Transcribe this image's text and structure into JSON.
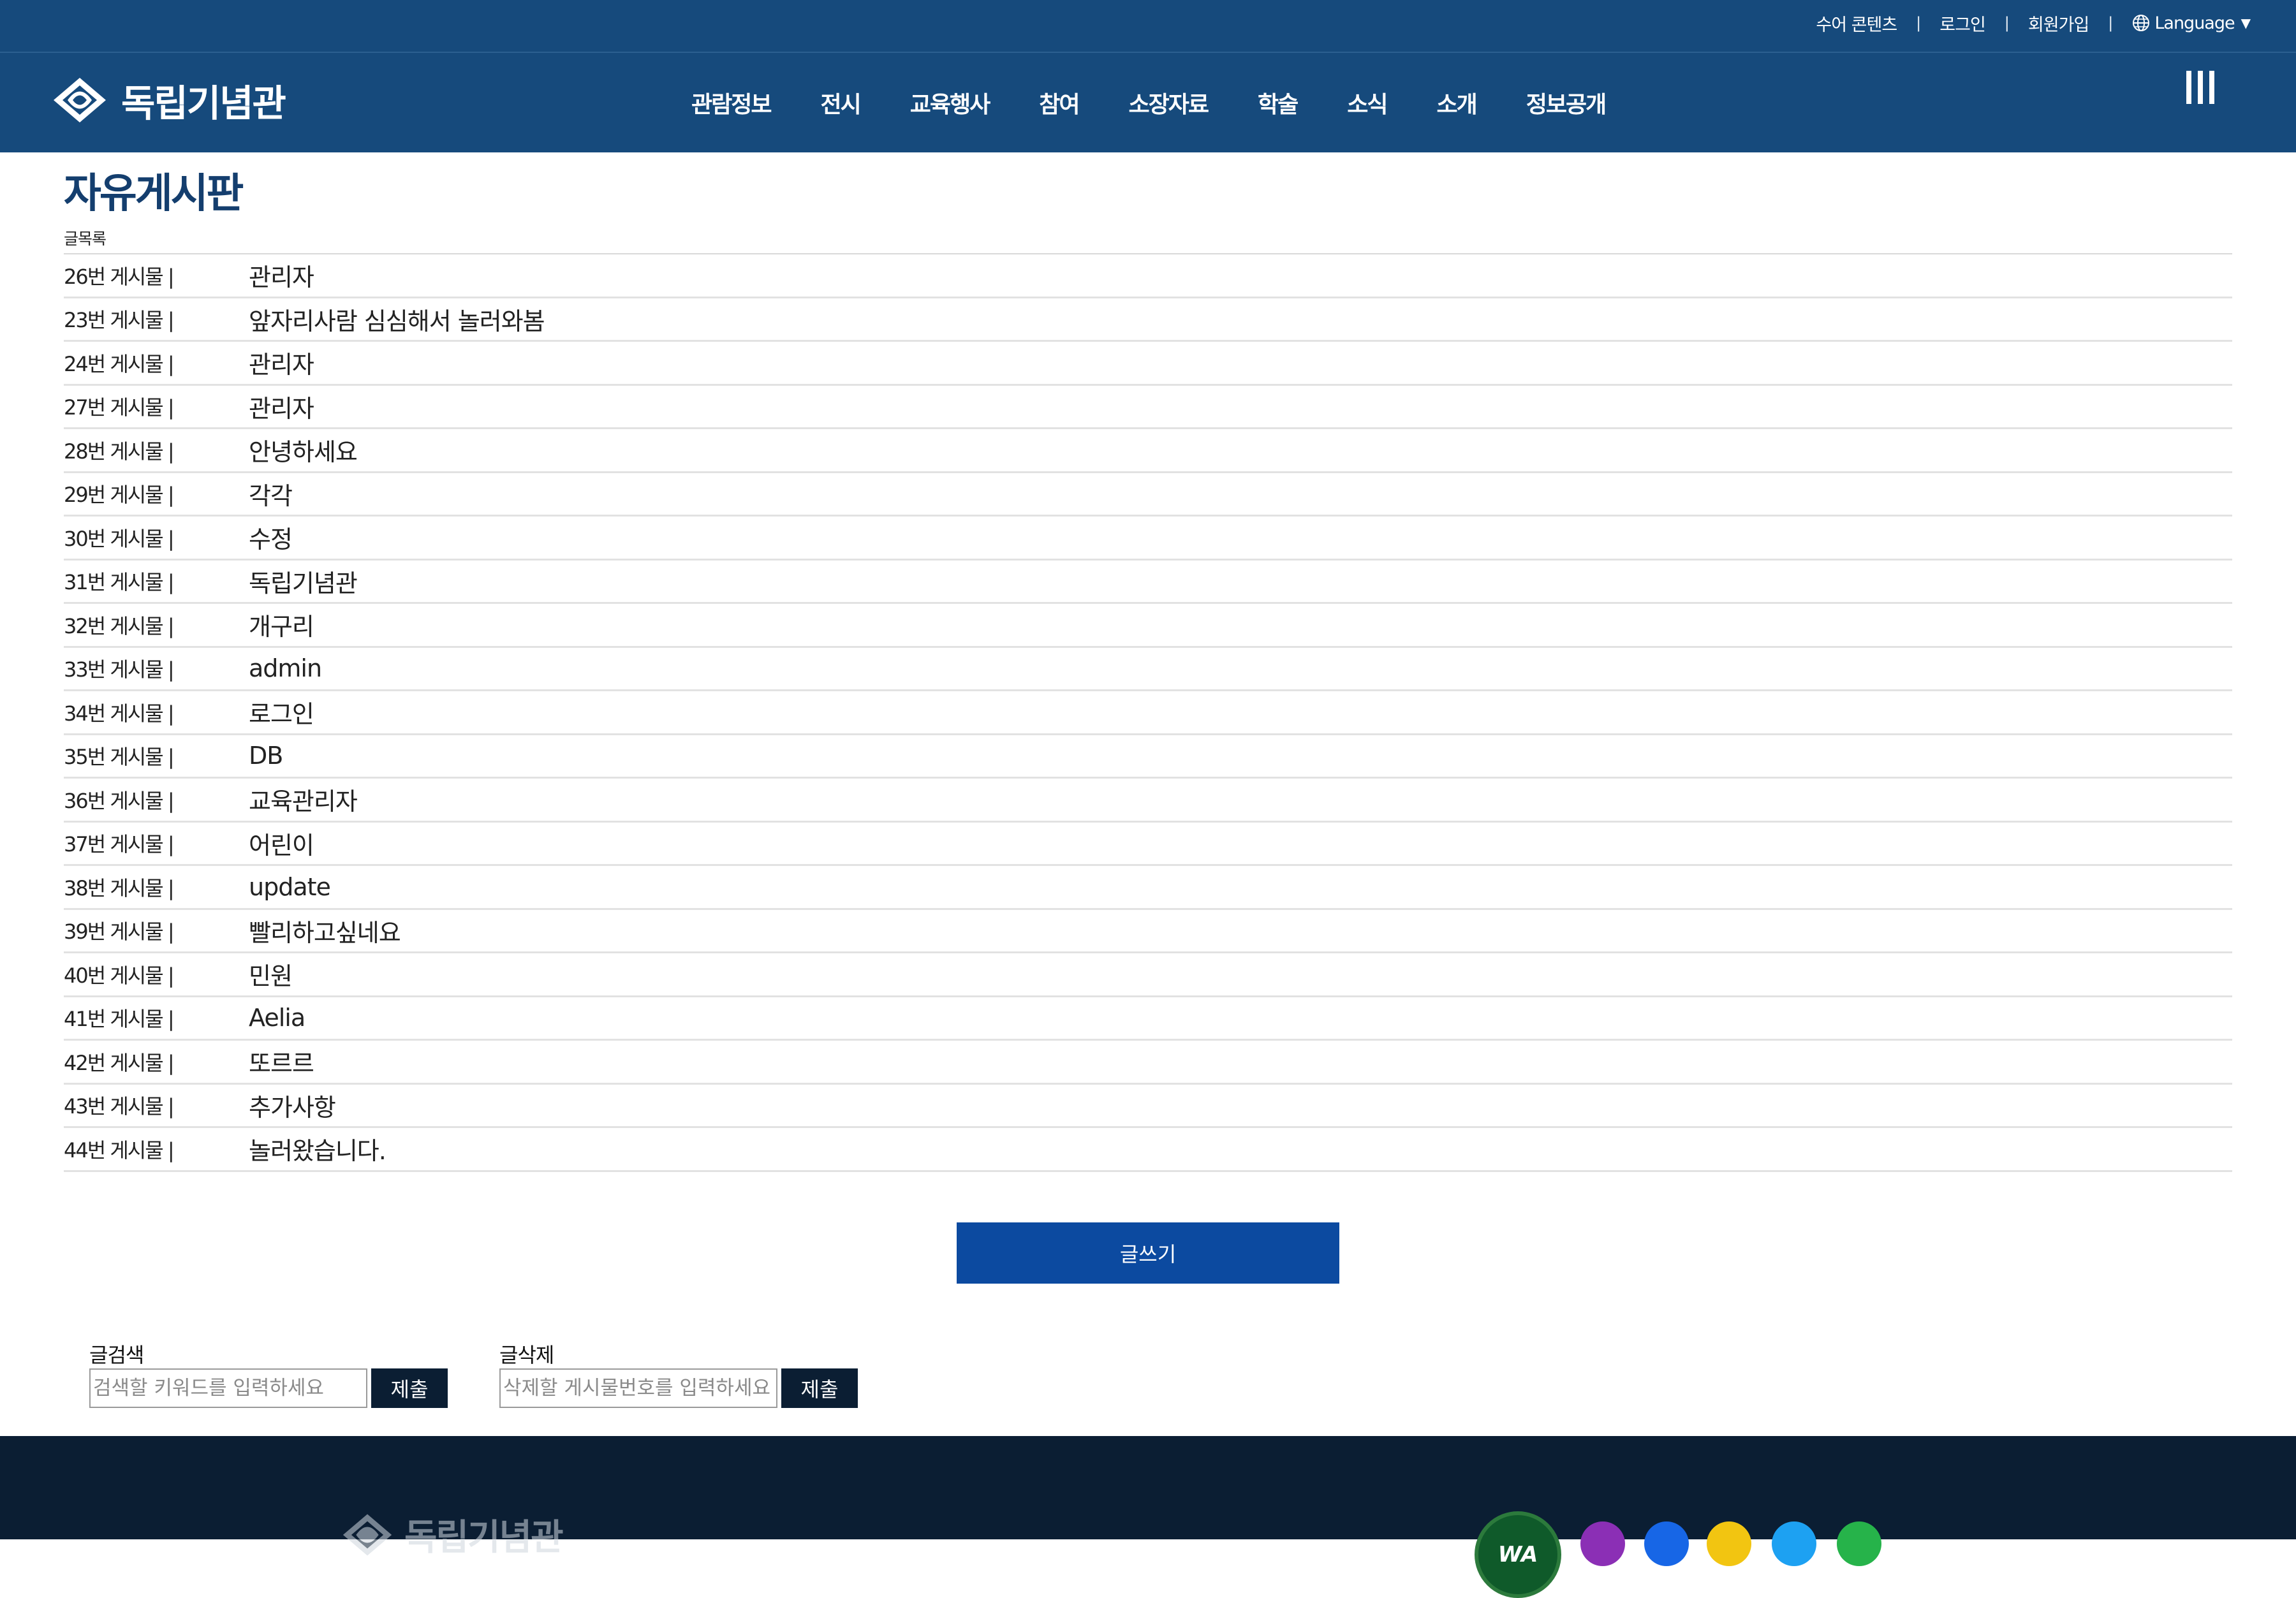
{
  "header": {
    "utility_links": [
      "수어 콘텐츠",
      "로그인",
      "회원가입"
    ],
    "separator": "|",
    "language_label": "Language",
    "language_caret": "▼",
    "logo_text": "독립기념관",
    "menu": [
      "관람정보",
      "전시",
      "교육행사",
      "참여",
      "소장자료",
      "학술",
      "소식",
      "소개",
      "정보공개"
    ]
  },
  "board": {
    "title": "자유게시판",
    "list_caption": "글목록",
    "posts": [
      {
        "num": "26번 게시물 |",
        "title": "관리자"
      },
      {
        "num": "23번 게시물 |",
        "title": "앞자리사람 심심해서 놀러와봄"
      },
      {
        "num": "24번 게시물 |",
        "title": "관리자"
      },
      {
        "num": "27번 게시물 |",
        "title": "관리자"
      },
      {
        "num": "28번 게시물 |",
        "title": "안녕하세요"
      },
      {
        "num": "29번 게시물 |",
        "title": "각각"
      },
      {
        "num": "30번 게시물 |",
        "title": "수정"
      },
      {
        "num": "31번 게시물 |",
        "title": "독립기념관"
      },
      {
        "num": "32번 게시물 |",
        "title": "개구리"
      },
      {
        "num": "33번 게시물 |",
        "title": "admin"
      },
      {
        "num": "34번 게시물 |",
        "title": "로그인"
      },
      {
        "num": "35번 게시물 |",
        "title": "DB"
      },
      {
        "num": "36번 게시물 |",
        "title": "교육관리자"
      },
      {
        "num": "37번 게시물 |",
        "title": "어린이"
      },
      {
        "num": "38번 게시물 |",
        "title": "update"
      },
      {
        "num": "39번 게시물 |",
        "title": "빨리하고싶네요"
      },
      {
        "num": "40번 게시물 |",
        "title": "민원"
      },
      {
        "num": "41번 게시물 |",
        "title": "Aelia"
      },
      {
        "num": "42번 게시물 |",
        "title": "또르르"
      },
      {
        "num": "43번 게시물 |",
        "title": "추가사항"
      },
      {
        "num": "44번 게시물 |",
        "title": "놀러왔습니다."
      }
    ],
    "write_button": "글쓰기"
  },
  "search_form": {
    "label": "글검색",
    "placeholder": "검색할 키워드를 입력하세요",
    "value": "",
    "submit": "제출"
  },
  "delete_form": {
    "label": "글삭제",
    "placeholder": "삭제할 게시물번호를 입력하세요",
    "value": "",
    "submit": "제출"
  },
  "footer": {
    "logo_text": "독립기념관",
    "badge_text": "WA",
    "social_icons": [
      "instagram-icon",
      "facebook-icon",
      "blog-icon",
      "twitter-icon",
      "youtube-icon"
    ]
  },
  "colors": {
    "header_bg": "#164a7c",
    "title": "#143e6e",
    "write_button": "#0c4aa0",
    "footer_bg": "#0b1e33",
    "submit_bg": "#0b1e33"
  }
}
